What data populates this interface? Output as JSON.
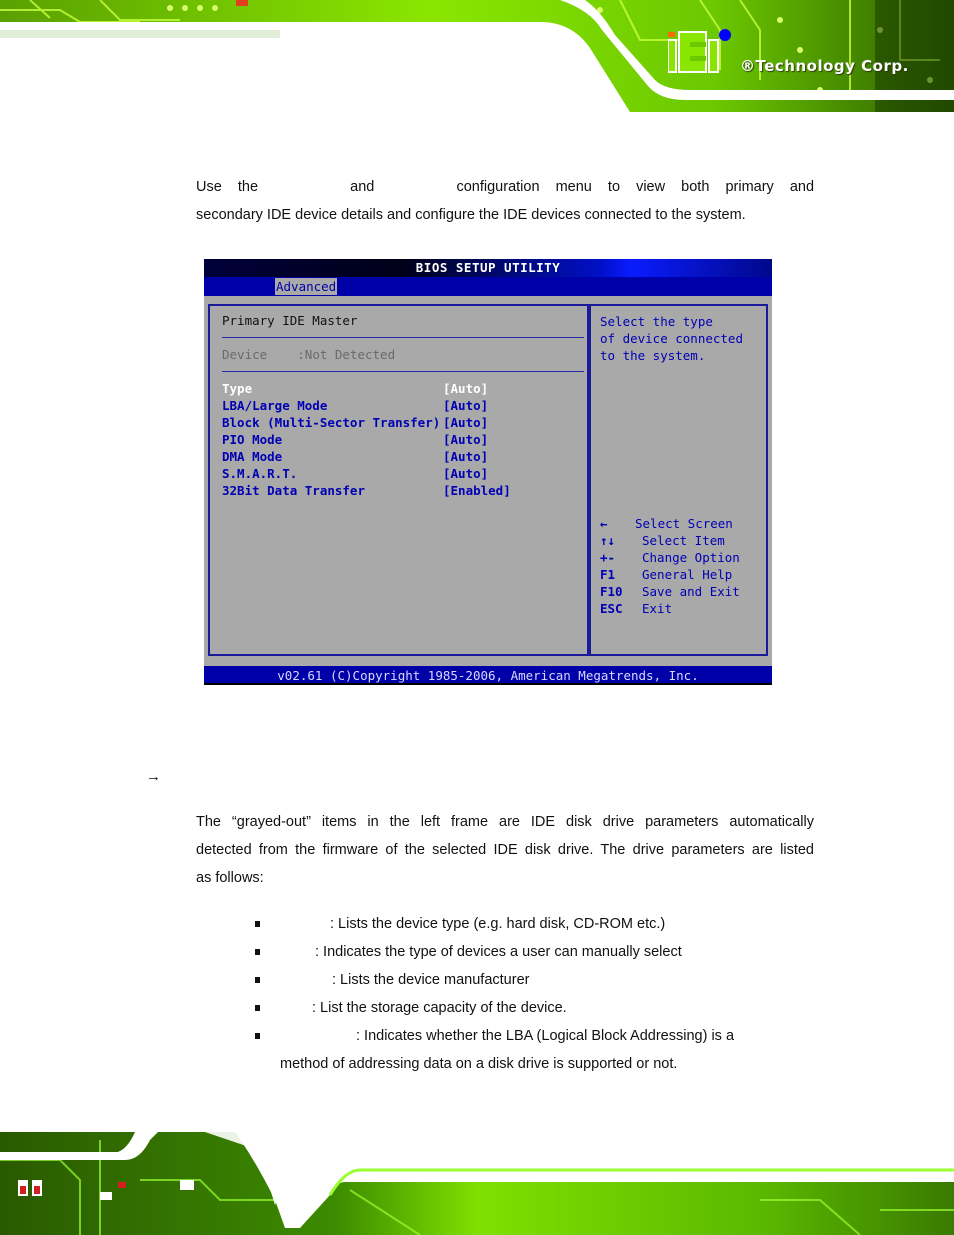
{
  "header": {
    "brand_mark": "iEi",
    "brand_text": "®Technology Corp.",
    "colors": {
      "pcb_green": "#7fe000",
      "pcb_dark": "#1a3a00",
      "swoosh": "#ffffff",
      "logo_orange": "#ff6a00",
      "logo_blue": "#0000ff"
    }
  },
  "intro": {
    "line1": [
      "Use",
      "the",
      "and",
      "configuration",
      "menu",
      "to",
      "view",
      "both",
      "primary",
      "and"
    ],
    "line2": "secondary IDE device details and configure the IDE devices connected to the system."
  },
  "bios": {
    "title": "BIOS SETUP UTILITY",
    "active_tab": "Advanced",
    "section_title": "Primary IDE Master",
    "device_label": "Device",
    "device_value": ":Not Detected",
    "items": [
      {
        "label": "Type",
        "value": "[Auto]",
        "selected": true
      },
      {
        "label": "LBA/Large Mode",
        "value": "[Auto]",
        "selected": false
      },
      {
        "label": "Block (Multi-Sector Transfer)",
        "value": "[Auto]",
        "selected": false
      },
      {
        "label": "PIO Mode",
        "value": "[Auto]",
        "selected": false
      },
      {
        "label": "DMA Mode",
        "value": "[Auto]",
        "selected": false
      },
      {
        "label": "S.M.A.R.T.",
        "value": "[Auto]",
        "selected": false
      },
      {
        "label": "32Bit Data Transfer",
        "value": "[Enabled]",
        "selected": false
      }
    ],
    "help_lines": [
      "Select the type",
      "of device connected",
      "to the system."
    ],
    "keys": [
      {
        "key": "←",
        "desc": "Select Screen"
      },
      {
        "key": "↑↓",
        "desc": "Select Item"
      },
      {
        "key": "+-",
        "desc": "Change Option"
      },
      {
        "key": "F1",
        "desc": "General Help"
      },
      {
        "key": "F10",
        "desc": "Save and Exit"
      },
      {
        "key": "ESC",
        "desc": "Exit"
      }
    ],
    "footer": "v02.61 (C)Copyright 1985-2006, American Megatrends, Inc.",
    "colors": {
      "background": "#a9a9a9",
      "menubar": "#0000a8",
      "text_blue": "#0000b4",
      "grayed": "#6a6a6a",
      "selected": "#ffffff"
    }
  },
  "section": {
    "arrow_icon": "→",
    "para_lines": [
      "The “grayed-out” items in the left frame are IDE disk drive parameters automatically",
      "detected from the firmware of the selected IDE disk drive. The drive parameters are listed",
      "as follows:"
    ],
    "bullets": [
      ": Lists the device type (e.g. hard disk, CD-ROM etc.)",
      ": Indicates the type of devices a user can manually select",
      ": Lists the device manufacturer",
      ": List the storage capacity of the device.",
      ": Indicates whether the LBA (Logical Block Addressing) is a"
    ],
    "bullet_continuation": "method of addressing data on a disk drive is supported or not."
  }
}
